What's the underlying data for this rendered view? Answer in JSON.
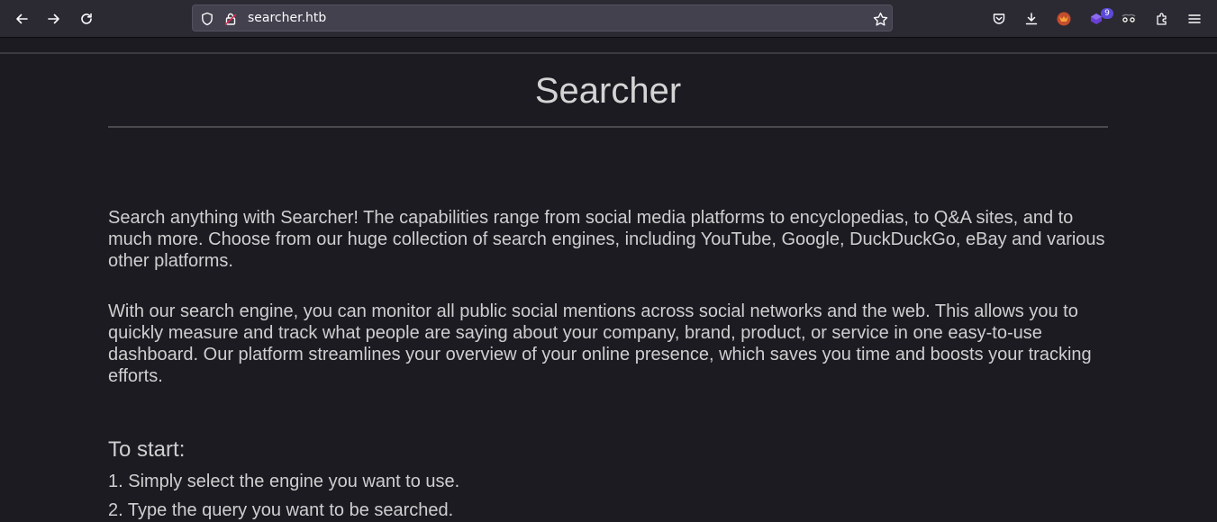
{
  "browser": {
    "url": "searcher.htb",
    "extension_badge": "9",
    "icons": {
      "back": "arrow-left-icon",
      "forward": "arrow-right-icon",
      "reload": "reload-icon",
      "tracking": "shield-icon",
      "lock": "lock-icon",
      "bookmark": "star-icon",
      "pocket": "pocket-icon",
      "downloads": "download-icon",
      "menu": "hamburger-menu-icon"
    }
  },
  "page": {
    "title": "Searcher",
    "paragraphs": [
      "Search anything with Searcher! The capabilities range from social media platforms to encyclopedias, to Q&A sites, and to much more. Choose from our huge collection of search engines, including YouTube, Google, DuckDuckGo, eBay and various other platforms.",
      "With our search engine, you can monitor all public social mentions across social networks and the web. This allows you to quickly measure and track what people are saying about your company, brand, product, or service in one easy-to-use dashboard. Our platform streamlines your overview of your online presence, which saves you time and boosts your tracking efforts."
    ],
    "start_heading": "To start:",
    "steps": [
      "1. Simply select the engine you want to use.",
      "2. Type the query you want to be searched."
    ]
  },
  "colors": {
    "page_background": "#1c1b22",
    "toolbar_background": "#2b2a33",
    "text": "#cfcfcf"
  }
}
